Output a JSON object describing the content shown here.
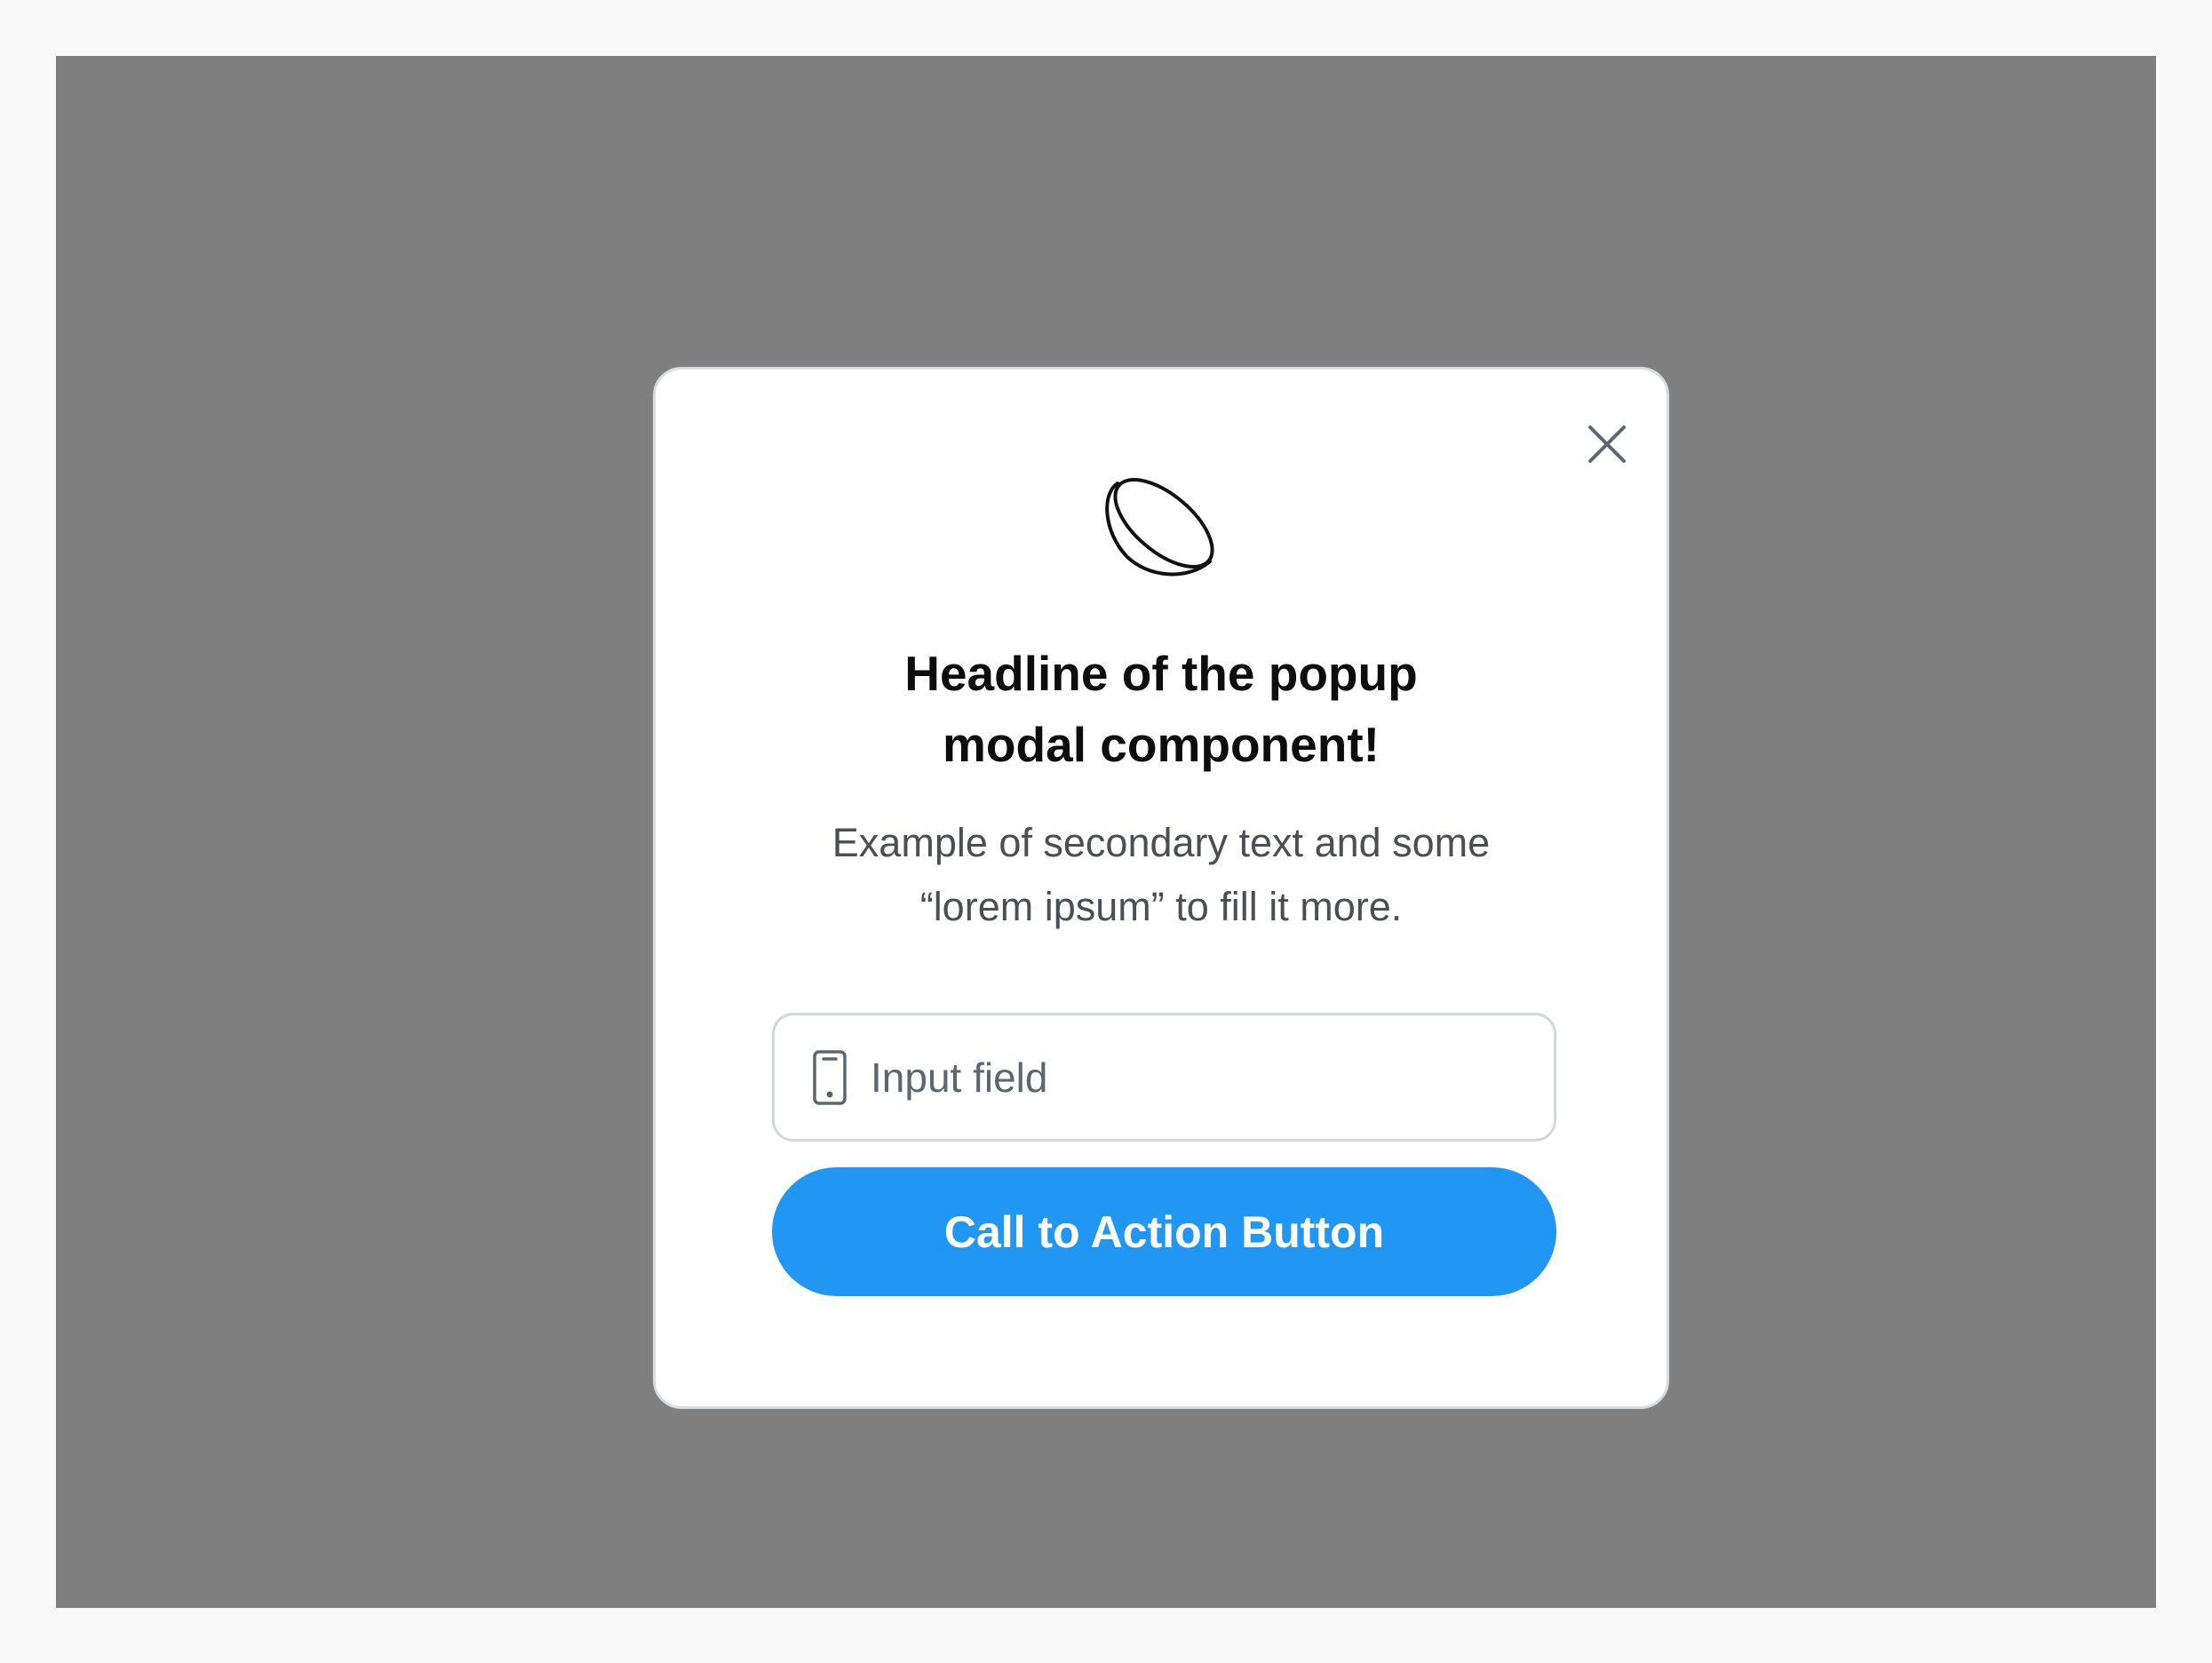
{
  "modal": {
    "headline_line1": "Headline of the popup",
    "headline_line2": "modal component!",
    "secondary_line1": "Example of secondary text and some",
    "secondary_line2": "“lorem ipsum” to fill it more.",
    "hero_icon": "lens-bowl-icon",
    "close_icon": "close-icon",
    "input": {
      "placeholder": "Input field",
      "value": "",
      "icon": "smartphone-icon"
    },
    "cta_label": "Call to Action Button"
  },
  "colors": {
    "page_background": "#f8f8f8",
    "overlay": "#7f7f7f",
    "modal_background": "#ffffff",
    "accent": "#2196f3",
    "headline_text": "#0d0d0d",
    "secondary_text": "#4b4f54",
    "icon_gray": "#5b6671"
  }
}
